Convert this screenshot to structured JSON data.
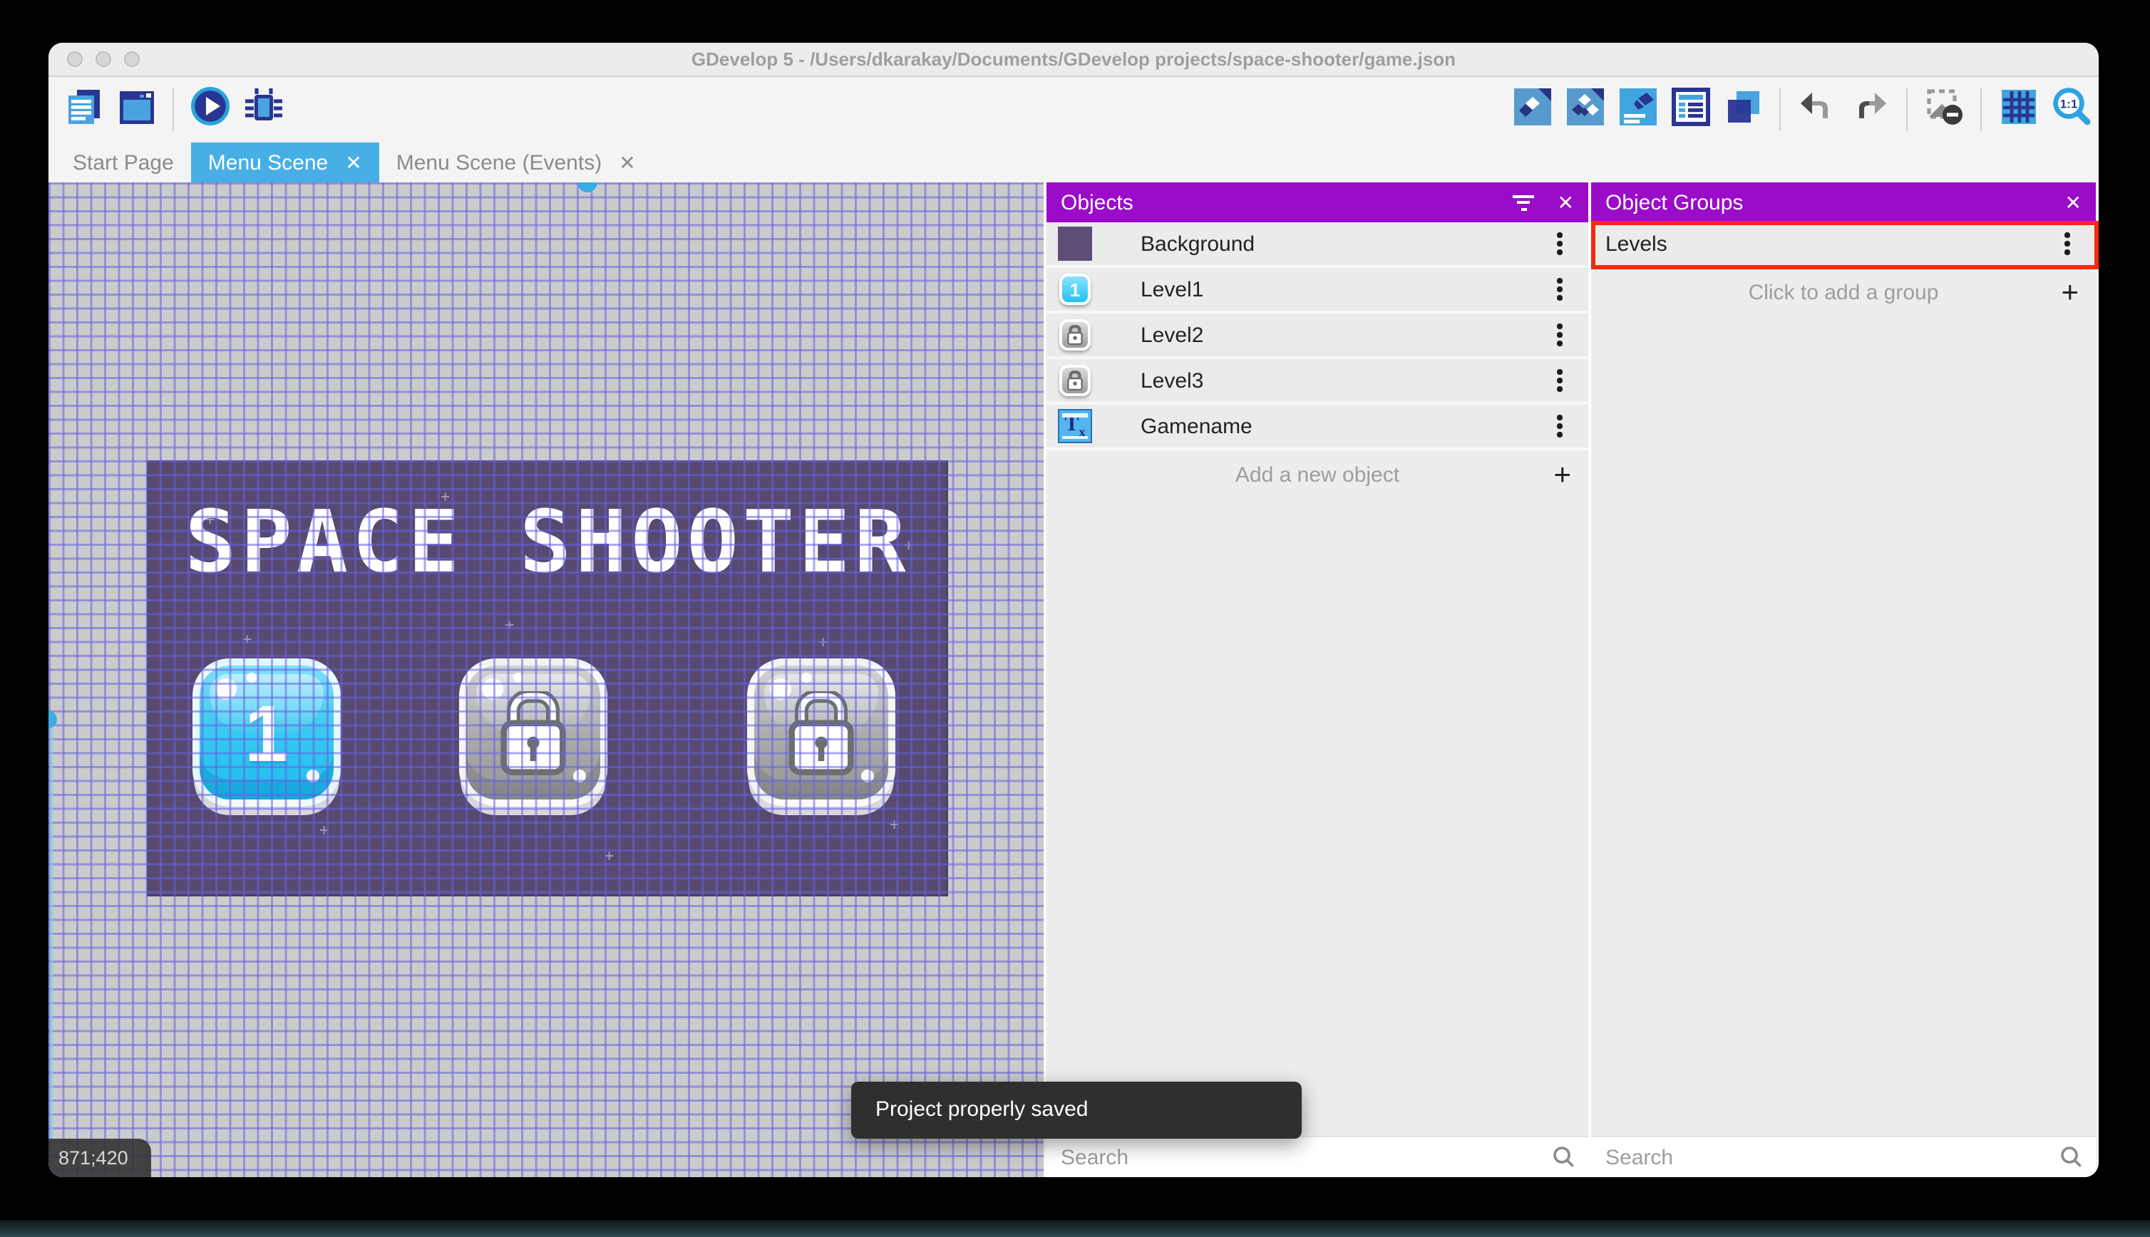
{
  "window": {
    "title": "GDevelop 5 - /Users/dkarakay/Documents/GDevelop projects/space-shooter/game.json"
  },
  "toolbar": {
    "left_icons": [
      "project-manager",
      "scene-editor-window",
      "play",
      "debug"
    ],
    "right_icons": [
      "objects-editor",
      "object-groups-editor",
      "scene-properties",
      "instances-list",
      "layers",
      "undo",
      "redo",
      "toggle-mask",
      "toggle-grid",
      "zoom-1-1"
    ]
  },
  "tabs": {
    "items": [
      {
        "label": "Start Page",
        "closable": false,
        "active": false
      },
      {
        "label": "Menu Scene",
        "closable": true,
        "active": true
      },
      {
        "label": "Menu Scene (Events)",
        "closable": true,
        "active": false
      }
    ]
  },
  "scene": {
    "title": "SPACE SHOOTER",
    "buttons": [
      {
        "label": "1",
        "state": "unlocked"
      },
      {
        "label": "",
        "state": "locked"
      },
      {
        "label": "",
        "state": "locked"
      }
    ]
  },
  "objects_panel": {
    "title": "Objects",
    "rows": [
      {
        "name": "Background",
        "icon": "background-thumbnail"
      },
      {
        "name": "Level1",
        "icon": "blue-button-thumbnail"
      },
      {
        "name": "Level2",
        "icon": "locked-button-thumbnail"
      },
      {
        "name": "Level3",
        "icon": "locked-button-thumbnail"
      },
      {
        "name": "Gamename",
        "icon": "text-object-thumbnail"
      }
    ],
    "add_label": "Add a new object",
    "search_placeholder": "Search"
  },
  "groups_panel": {
    "title": "Object Groups",
    "rows": [
      {
        "name": "Levels",
        "highlighted": true
      }
    ],
    "add_label": "Click to add a group",
    "search_placeholder": "Search"
  },
  "toast": {
    "message": "Project properly saved"
  },
  "status": {
    "coordinates": "871;420"
  },
  "glyphs": {
    "close": "✕",
    "plus": "+"
  },
  "colors": {
    "accent_purple": "#9a0cc8",
    "tab_blue": "#47afe6",
    "annotation_red": "#f5290f",
    "scene_purple": "#574a70",
    "grid_blue": "#6761e2"
  }
}
